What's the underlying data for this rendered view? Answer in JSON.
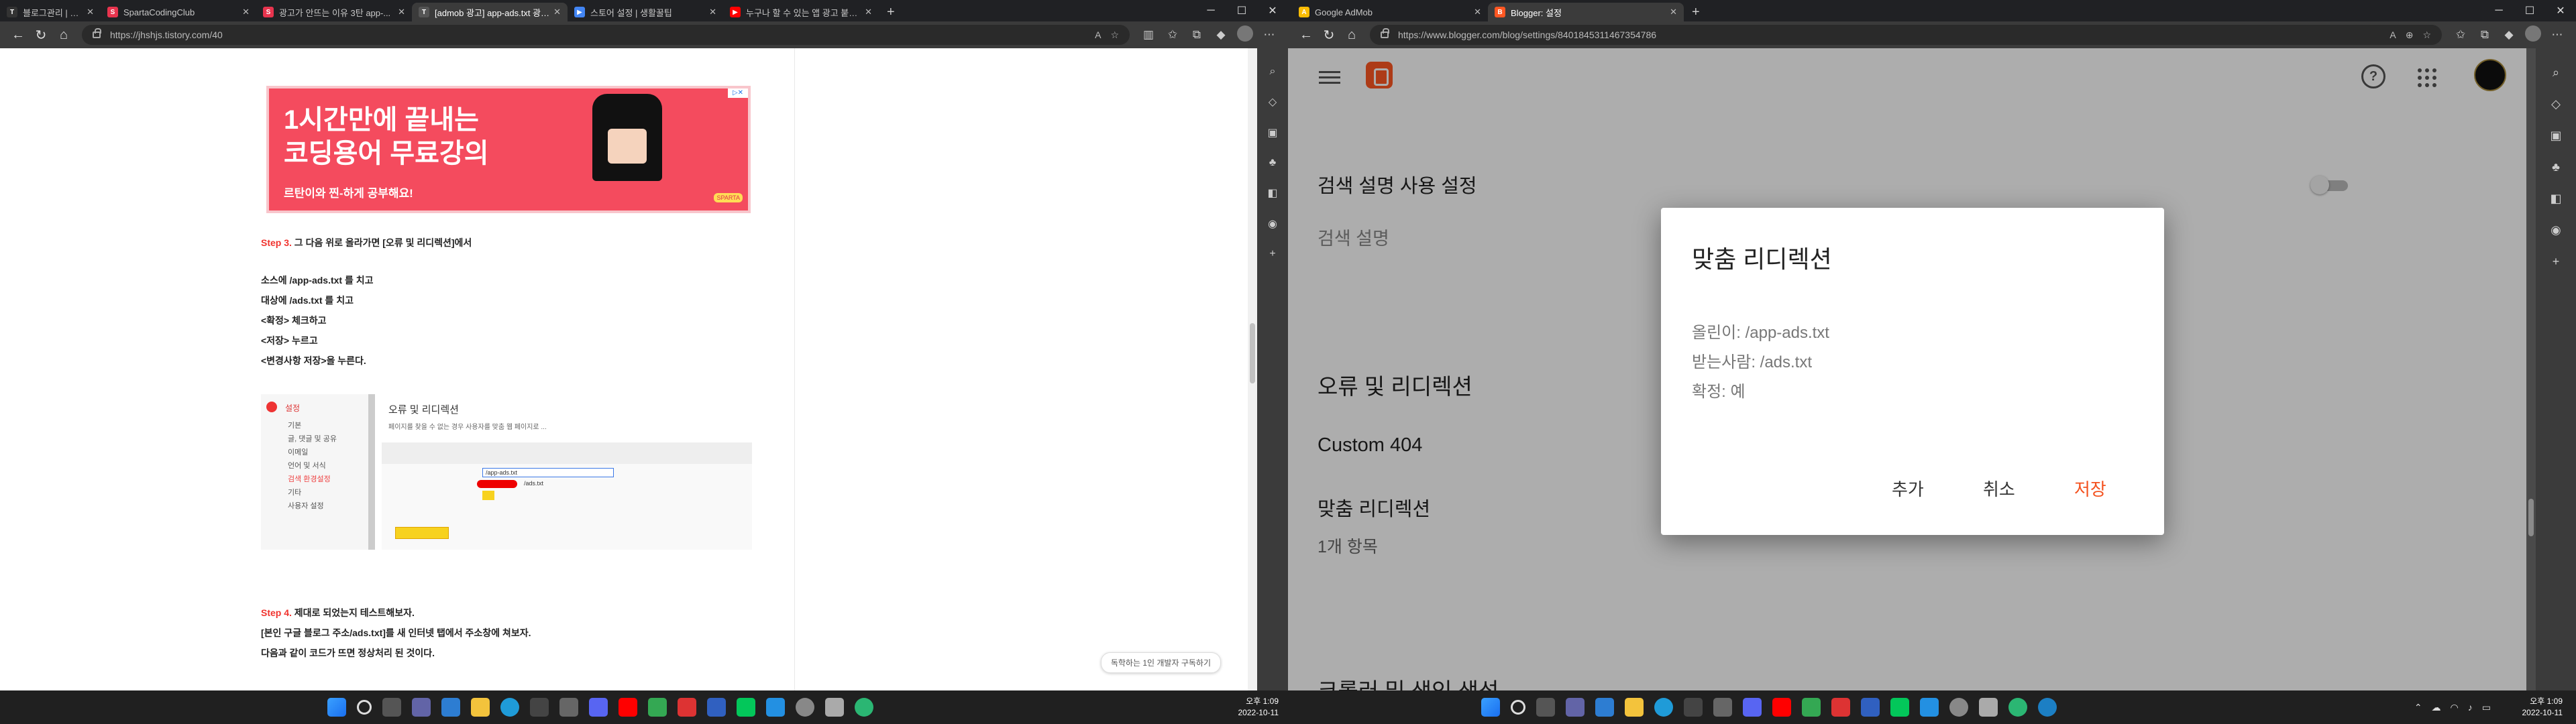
{
  "left_window": {
    "tabs": [
      {
        "title": "블로그관리 | TISTORY",
        "color": "#333333",
        "glyph": "T"
      },
      {
        "title": "SpartaCodingClub",
        "color": "#e8344e",
        "glyph": "S"
      },
      {
        "title": "광고가 안뜨는 이유 3탄 app-...",
        "color": "#e8344e",
        "glyph": "S"
      },
      {
        "title": "[admob 광고] app-ads.txt 광고...",
        "color": "#333333",
        "glyph": "T",
        "active": true
      },
      {
        "title": "스토어 설정 | 생활꿀팁",
        "color": "#4285f4",
        "glyph": "▶"
      },
      {
        "title": "누구나 할 수 있는 앱 광고 붙이...",
        "color": "#ff0000",
        "glyph": "▶"
      }
    ],
    "url": "https://jhshjs.tistory.com/40",
    "banner": {
      "line1": "1시간만에 끝내는",
      "line2": "코딩용어 무료강의",
      "line3": "르탄이와 찐-하게 공부해요!",
      "tag": "SPARTA"
    },
    "step3_label": "Step 3.",
    "step3_text": "그 다음 위로 올라가면 [오류 및 리디렉션]에서",
    "lines": [
      "소스에 /app-ads.txt 를 치고",
      "대상에 /ads.txt 를 치고",
      "<확정> 체크하고",
      "<저장> 누르고",
      "<변경사항 저장>을 누른다."
    ],
    "shot": {
      "settings": "설정",
      "items": [
        "기본",
        "글, 댓글 및 공유",
        "이메일",
        "언어 및 서식",
        "검색 환경설정",
        "기타",
        "사용자 설정"
      ],
      "heading": "오류 및 리디렉션",
      "desc": "페이지를 찾을 수 없는 경우 사용자를 맞춤 웹 페이지로 ...",
      "source_value": "/app-ads.txt",
      "target_value": "/ads.txt"
    },
    "step4_label": "Step 4.",
    "step4_text": "제대로 되었는지 테스트해보자.",
    "step4_line2": "[본인 구글 블로그 주소/ads.txt]를 새 인터넷 탭에서 주소창에 쳐보자.",
    "step4_line3": "다음과 같이 코드가 뜨면 정상처리 된 것이다.",
    "footer_link": "독학하는 1인 개발자 구독하기"
  },
  "right_window": {
    "tabs": [
      {
        "title": "Google AdMob",
        "color": "#fbbc04",
        "glyph": "A"
      },
      {
        "title": "Blogger: 설정",
        "color": "#ff5722",
        "glyph": "B",
        "active": true
      }
    ],
    "url": "https://www.blogger.com/blog/settings/8401845311467354786",
    "rows": {
      "search_desc_toggle_label": "검색 설명 사용 설정",
      "search_desc": "검색 설명",
      "errors_heading": "오류 및 리디렉션",
      "custom404": "Custom 404",
      "custom_redirect": "맞춤 리디렉션",
      "count": "1개 항목",
      "cutoff": "크롤러 및 색인 생성"
    },
    "dialog": {
      "title": "맞춤 리디렉션",
      "from": "올린이: /app-ads.txt",
      "to": "받는사람: /ads.txt",
      "permanent": "확정: 예",
      "add": "추가",
      "cancel": "취소",
      "save": "저장"
    }
  },
  "taskbar_left": {
    "time": "오후 1:09",
    "date": "2022-10-11"
  },
  "taskbar_right": {
    "time": "오후 1:09",
    "date": "2022-10-11"
  }
}
